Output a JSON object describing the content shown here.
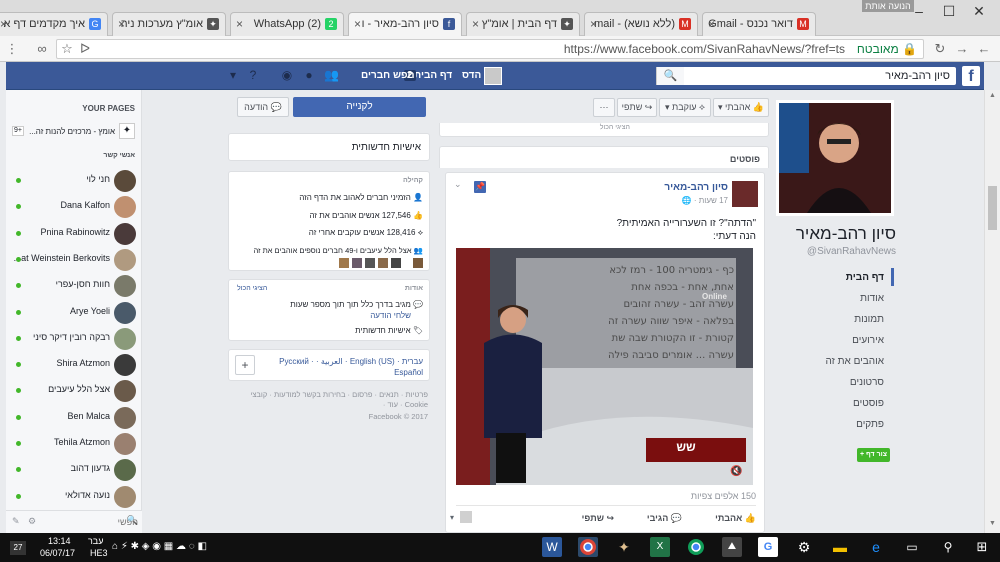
{
  "browser": {
    "profile_badge": "הנועה אותת",
    "tabs": [
      {
        "label": "דואר נכנס - Gmail",
        "fav": "M",
        "fav_color": "#d93025"
      },
      {
        "label": "(ללא נושא) - mail",
        "fav": "M",
        "fav_color": "#d93025"
      },
      {
        "label": "דף הבית | אומ\"ץ",
        "fav": "✦",
        "fav_color": "#555"
      },
      {
        "label": "סיון רהב-מאיר - ו",
        "fav": "f",
        "fav_color": "#3b5998"
      },
      {
        "label": "(2) WhatsApp",
        "fav": "2",
        "fav_color": "#25d366"
      },
      {
        "label": "אומ\"ץ מערכות ניה",
        "fav": "✦",
        "fav_color": "#555"
      },
      {
        "label": "איך מקדמים דף א",
        "fav": "G",
        "fav_color": "#4285f4"
      }
    ],
    "url": "https://www.facebook.com/SivanRahavNews/?fref=ts",
    "secure_label": "מאובטח"
  },
  "fb_header": {
    "search_value": "סיון רהב-מאיר",
    "user_name": "הדס",
    "home_label": "דף הבית",
    "home_count": "2",
    "find_friends": "חפש חברים"
  },
  "profile": {
    "name": "סיון רהב-מאיר",
    "handle": "@SivanRahavNews",
    "nav": [
      "דף הבית",
      "אודות",
      "תמונות",
      "אירועים",
      "אוהבים את זה",
      "סרטונים",
      "פוסטים",
      "פתקים"
    ],
    "create_page": "צור דף +"
  },
  "actions": {
    "liked": "אהבתי",
    "following": "עוקבת",
    "share": "שתפי",
    "more": "···",
    "shop": "לקנייה",
    "message": "הודעה"
  },
  "posts": {
    "section_title": "פוסטים",
    "prev_text": "הציגי הכול",
    "author": "סיון רהב-מאיר",
    "time": "17 שעות",
    "text_line1": "\"הדתה\"? זו השערורייה האמיתית?",
    "text_line2": "הנה דעתי:",
    "video_overlay_right": "Online",
    "video_board_lines": [
      "כף - גימטריה 100 - רמז לכא",
      "אחת, אחת - בכפה אחת",
      "עשרה זהב - עשרה זהובים",
      "בפלאה - איפר שווה עשרה זה",
      "קטורת - זו הקטורת שבה שת",
      "עשרה ... אומרים סביבה פילה"
    ],
    "views": "150 אלפים צפיות",
    "footer_like": "אהבתי",
    "footer_comment": "הגיבי",
    "footer_share": "שתפי"
  },
  "right_column": {
    "community_title": "אישיות חדשותית",
    "community_label": "קהילה",
    "invite": "הזמיני חברים לאהוב את הדף הזה",
    "likes": "127,546 אנשים אוהבים את זה",
    "follows": "128,416 אנשים עוקבים אחרי זה",
    "friends_like": "אצל הלל עיעבים ו-49 חברים נוספים אוהבים את זה",
    "about_label": "אודות",
    "show_all": "הציגי הכול",
    "response": "מגיב בדרך כלל תוך תוך מספר שעות",
    "send_message": "שלחי הודעה",
    "category": "אישיות חדשותית",
    "languages": "עברית · English (US) · العربية · Русский · Español",
    "footer_links": "פרטיות · תנאים · פרסום · בחירות בקשר למודעות · קובצי Cookie · עוד ·",
    "copyright": "Facebook © 2017"
  },
  "chat": {
    "your_pages_title": "YOUR PAGES",
    "page_item": "אומץ - מרכזים להנות זה...",
    "page_badge": "9+",
    "contacts_title": "אנשי קשר",
    "contacts": [
      "חני לוי",
      "Dana Kalfon",
      "Pnina Rabinowitz",
      "...at Weinstein Berkovits",
      "חוות חסן-עפרי",
      "Arye Yoeli",
      "רבקה רובין דיקר סיני",
      "Shira Atzmon",
      "אצל הלל עיעבים",
      "Ben Malca",
      "Tehila Atzmon",
      "גדעון דהוב",
      "נועה אדולאי"
    ],
    "search_placeholder": "חפשי"
  },
  "taskbar": {
    "time": "13:14",
    "date": "06/07/17",
    "lang": "עבר",
    "layout": "HE3",
    "notif_count": "27"
  }
}
